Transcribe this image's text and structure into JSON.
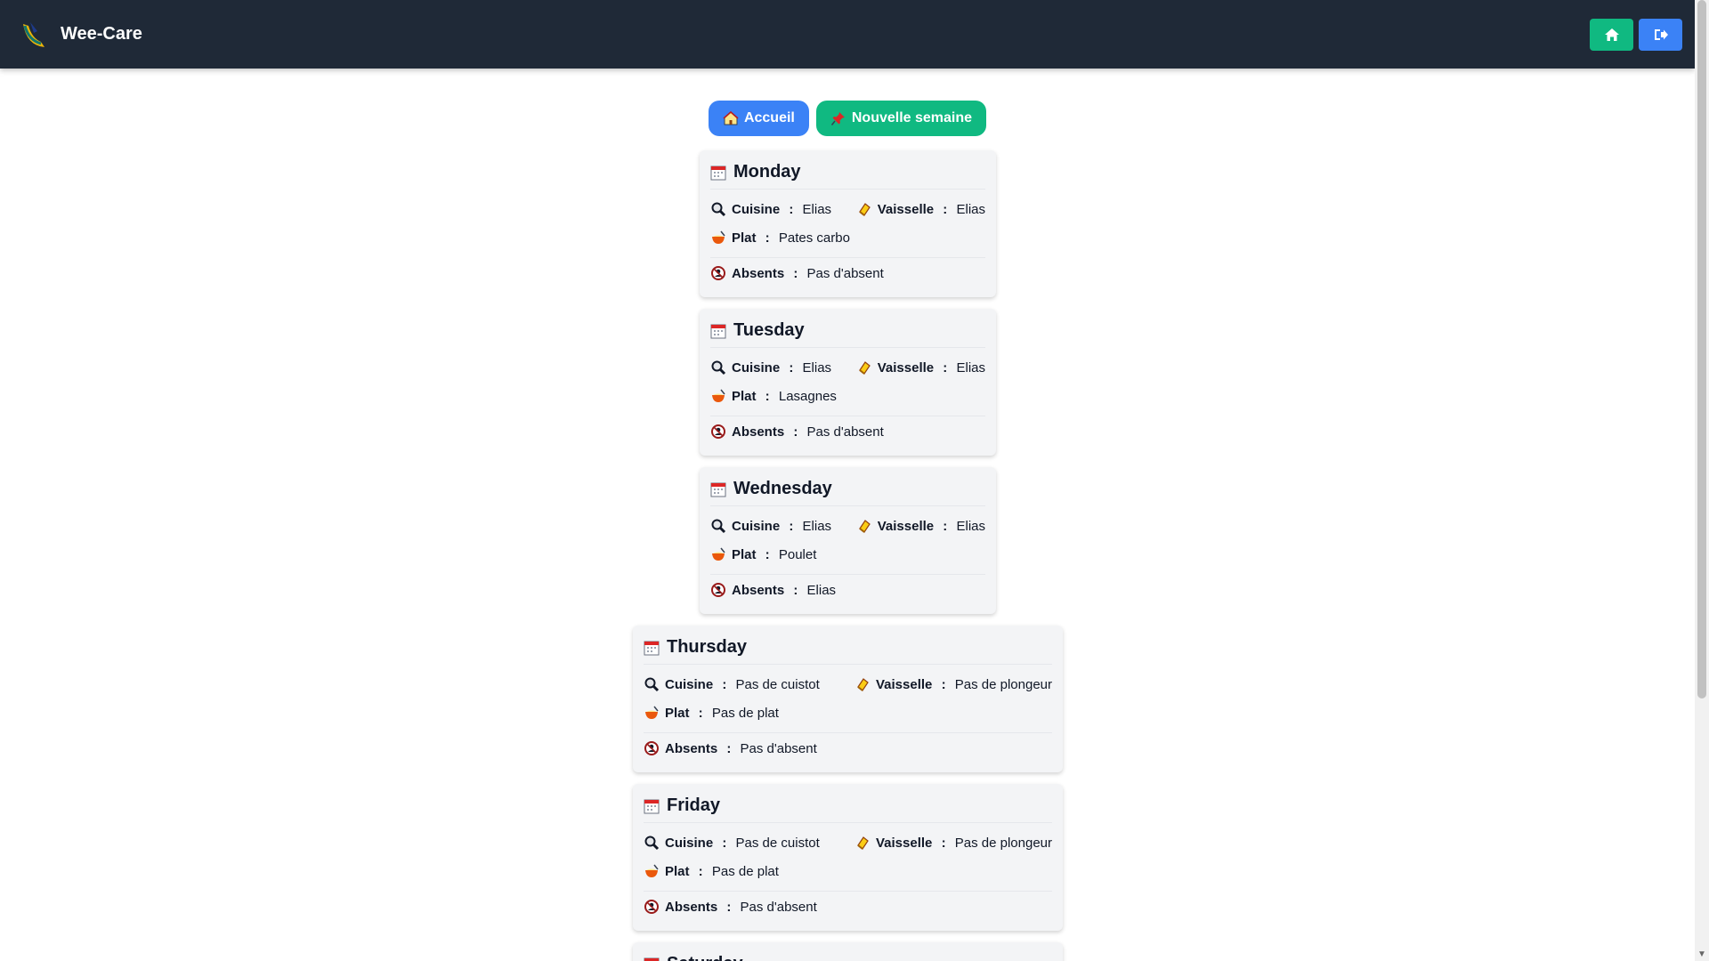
{
  "app": {
    "name": "Wee-Care"
  },
  "nav": {
    "home_label": "Accueil",
    "new_week_label": "Nouvelle semaine"
  },
  "labels": {
    "cuisine": "Cuisine",
    "vaisselle": "Vaisselle",
    "plat": "Plat",
    "absents": "Absents",
    "colon": " :"
  },
  "days": [
    {
      "day": "Monday",
      "cuisine": "Elias",
      "vaisselle": "Elias",
      "plat": "Pates carbo",
      "absents": "Pas d'absent"
    },
    {
      "day": "Tuesday",
      "cuisine": "Elias",
      "vaisselle": "Elias",
      "plat": "Lasagnes",
      "absents": "Pas d'absent"
    },
    {
      "day": "Wednesday",
      "cuisine": "Elias",
      "vaisselle": "Elias",
      "plat": "Poulet",
      "absents": "Elias"
    },
    {
      "day": "Thursday",
      "cuisine": "Pas de cuistot",
      "vaisselle": "Pas de plongeur",
      "plat": "Pas de plat",
      "absents": "Pas d'absent"
    },
    {
      "day": "Friday",
      "cuisine": "Pas de cuistot",
      "vaisselle": "Pas de plongeur",
      "plat": "Pas de plat",
      "absents": "Pas d'absent"
    },
    {
      "day": "Saturday"
    }
  ],
  "colors": {
    "navbar": "#1f2937",
    "green": "#10b981",
    "blue": "#3b82f6",
    "card": "#f3f4f6"
  },
  "icons": {
    "calendar": "calendar-icon",
    "cuisine": "magnifier-icon",
    "vaisselle": "sponge-icon",
    "plat": "bowl-icon",
    "absents": "absent-icon",
    "home": "home-icon",
    "logout": "logout-icon",
    "pin": "pushpin-icon"
  }
}
